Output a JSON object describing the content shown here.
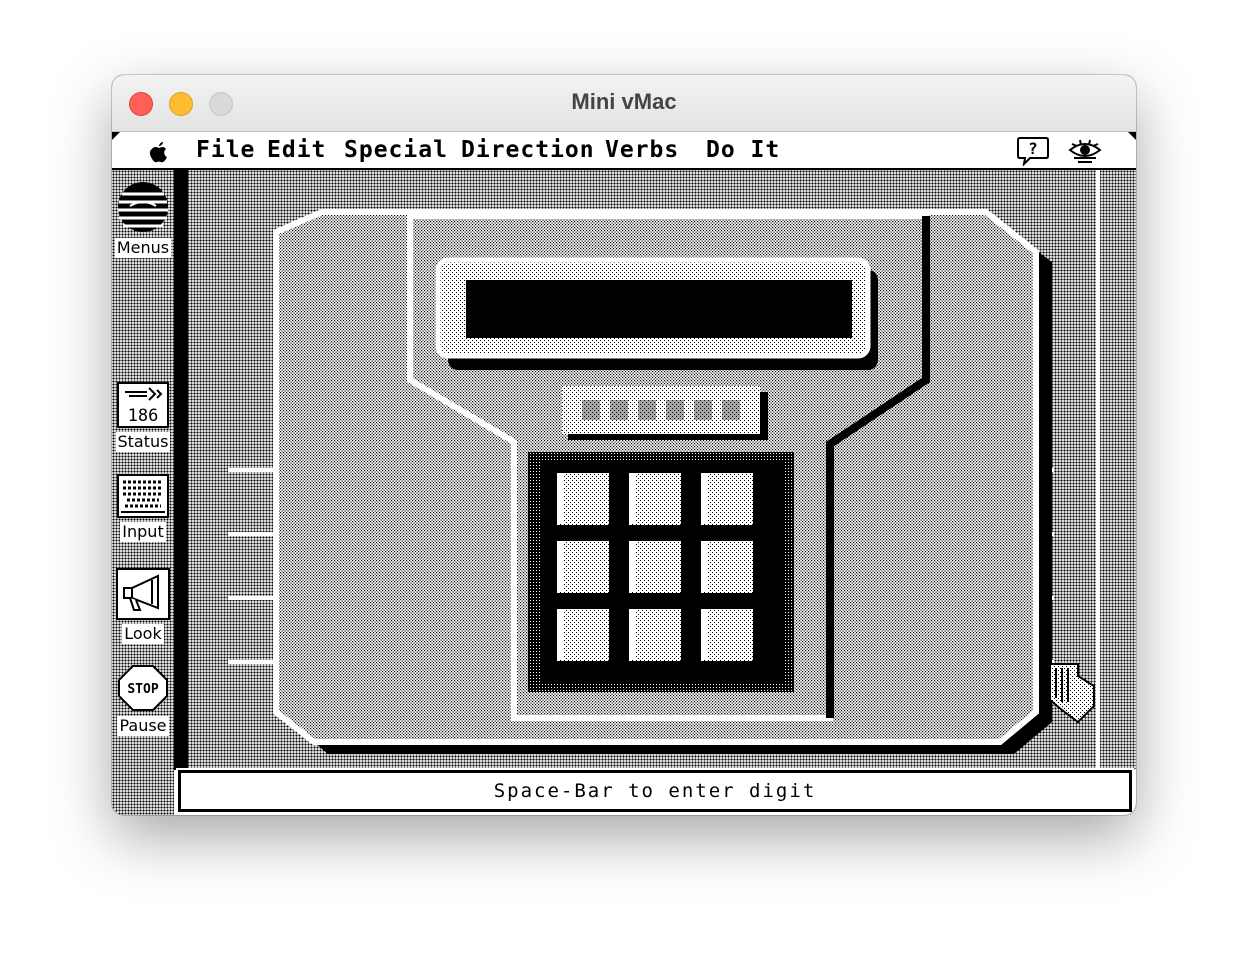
{
  "window": {
    "title": "Mini vMac"
  },
  "menubar": {
    "items": [
      "File",
      "Edit",
      "Special",
      "Direction",
      "Verbs",
      "Do It"
    ],
    "help_icon": "question-balloon-icon",
    "eye_icon": "eye-icon"
  },
  "sidebar": {
    "menus": "Menus",
    "status_value": "186",
    "status": "Status",
    "input": "Input",
    "look": "Look",
    "stop_text": "STOP",
    "pause": "Pause"
  },
  "status_bar": {
    "message": "Space-Bar to enter digit"
  }
}
